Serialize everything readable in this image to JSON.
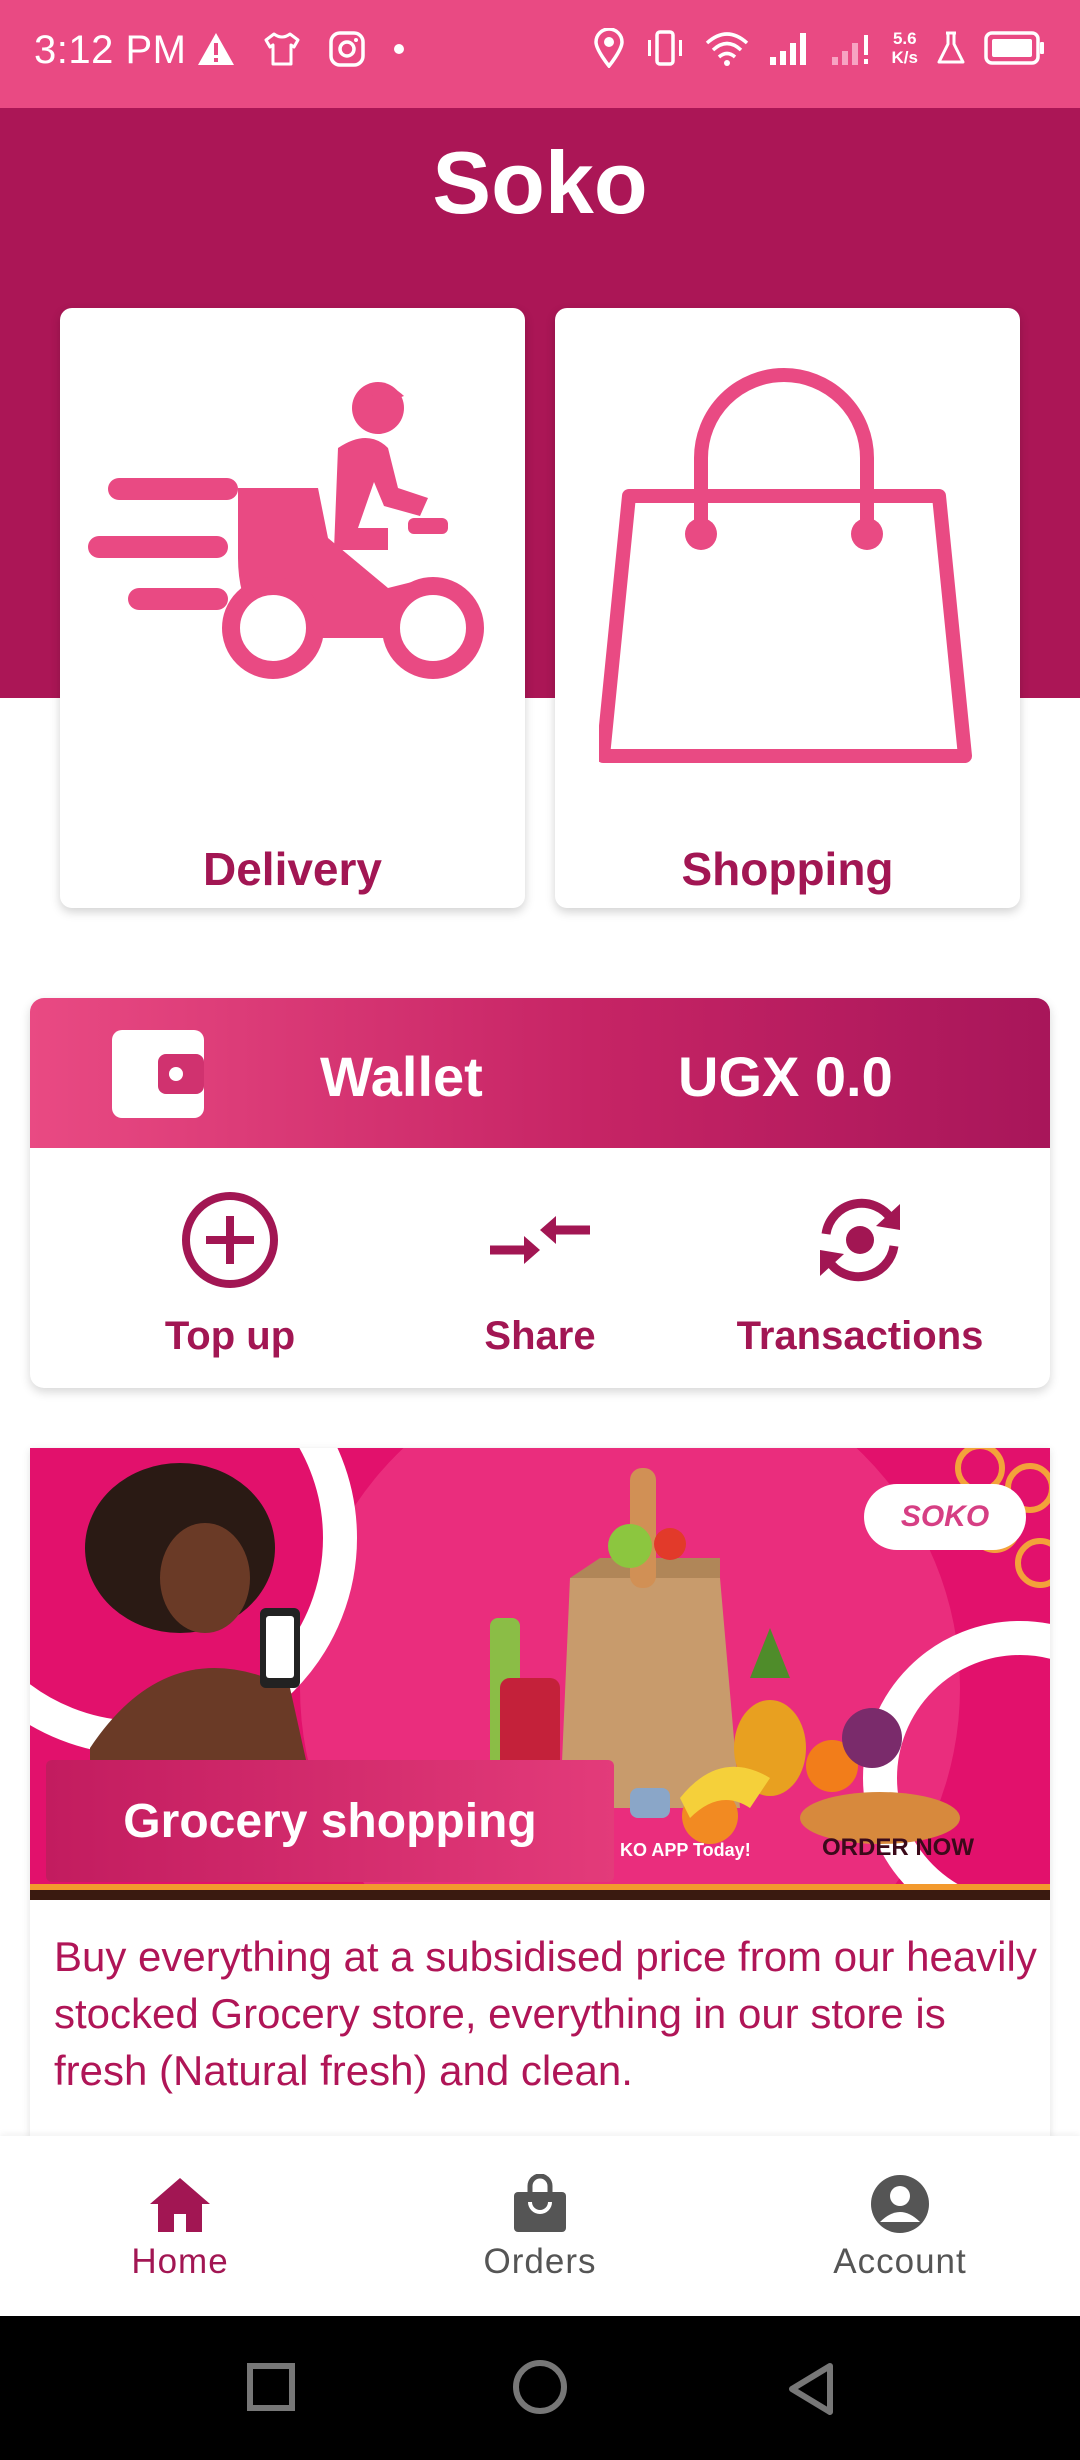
{
  "status_bar": {
    "time": "3:12 PM",
    "network_speed_value": "5.6",
    "network_speed_unit": "K/s",
    "left_icons": [
      "warning-icon",
      "tshirt-icon",
      "instagram-icon",
      "dot-icon"
    ],
    "right_icons": [
      "location-icon",
      "vibrate-icon",
      "wifi-icon",
      "signal-icon",
      "signal-alert-icon",
      "lab-icon",
      "battery-icon"
    ]
  },
  "header": {
    "title": "Soko"
  },
  "services": [
    {
      "label": "Delivery",
      "icon": "scooter-icon"
    },
    {
      "label": "Shopping",
      "icon": "shopping-bag-icon"
    }
  ],
  "wallet": {
    "label": "Wallet",
    "balance": "UGX 0.0",
    "actions": [
      {
        "label": "Top up",
        "icon": "add-circle-icon"
      },
      {
        "label": "Share",
        "icon": "transfer-arrows-icon"
      },
      {
        "label": "Transactions",
        "icon": "sync-icon"
      }
    ]
  },
  "promo": {
    "banner_title": "Grocery shopping",
    "banner_logo_text": "SOKO",
    "banner_app_text": "KO APP Today!",
    "banner_order_text": "ORDER NOW",
    "description": "Buy everything at a subsidised price from our heavily stocked Grocery store, everything in our store is fresh (Natural fresh) and clean."
  },
  "bottom_nav": {
    "items": [
      {
        "label": "Home",
        "icon": "home-icon",
        "active": true
      },
      {
        "label": "Orders",
        "icon": "orders-bag-icon",
        "active": false
      },
      {
        "label": "Account",
        "icon": "account-circle-icon",
        "active": false
      }
    ]
  },
  "colors": {
    "status_bar": "#e94a83",
    "header": "#ab1656",
    "accent": "#a21653",
    "icon_pink": "#e94a83"
  }
}
